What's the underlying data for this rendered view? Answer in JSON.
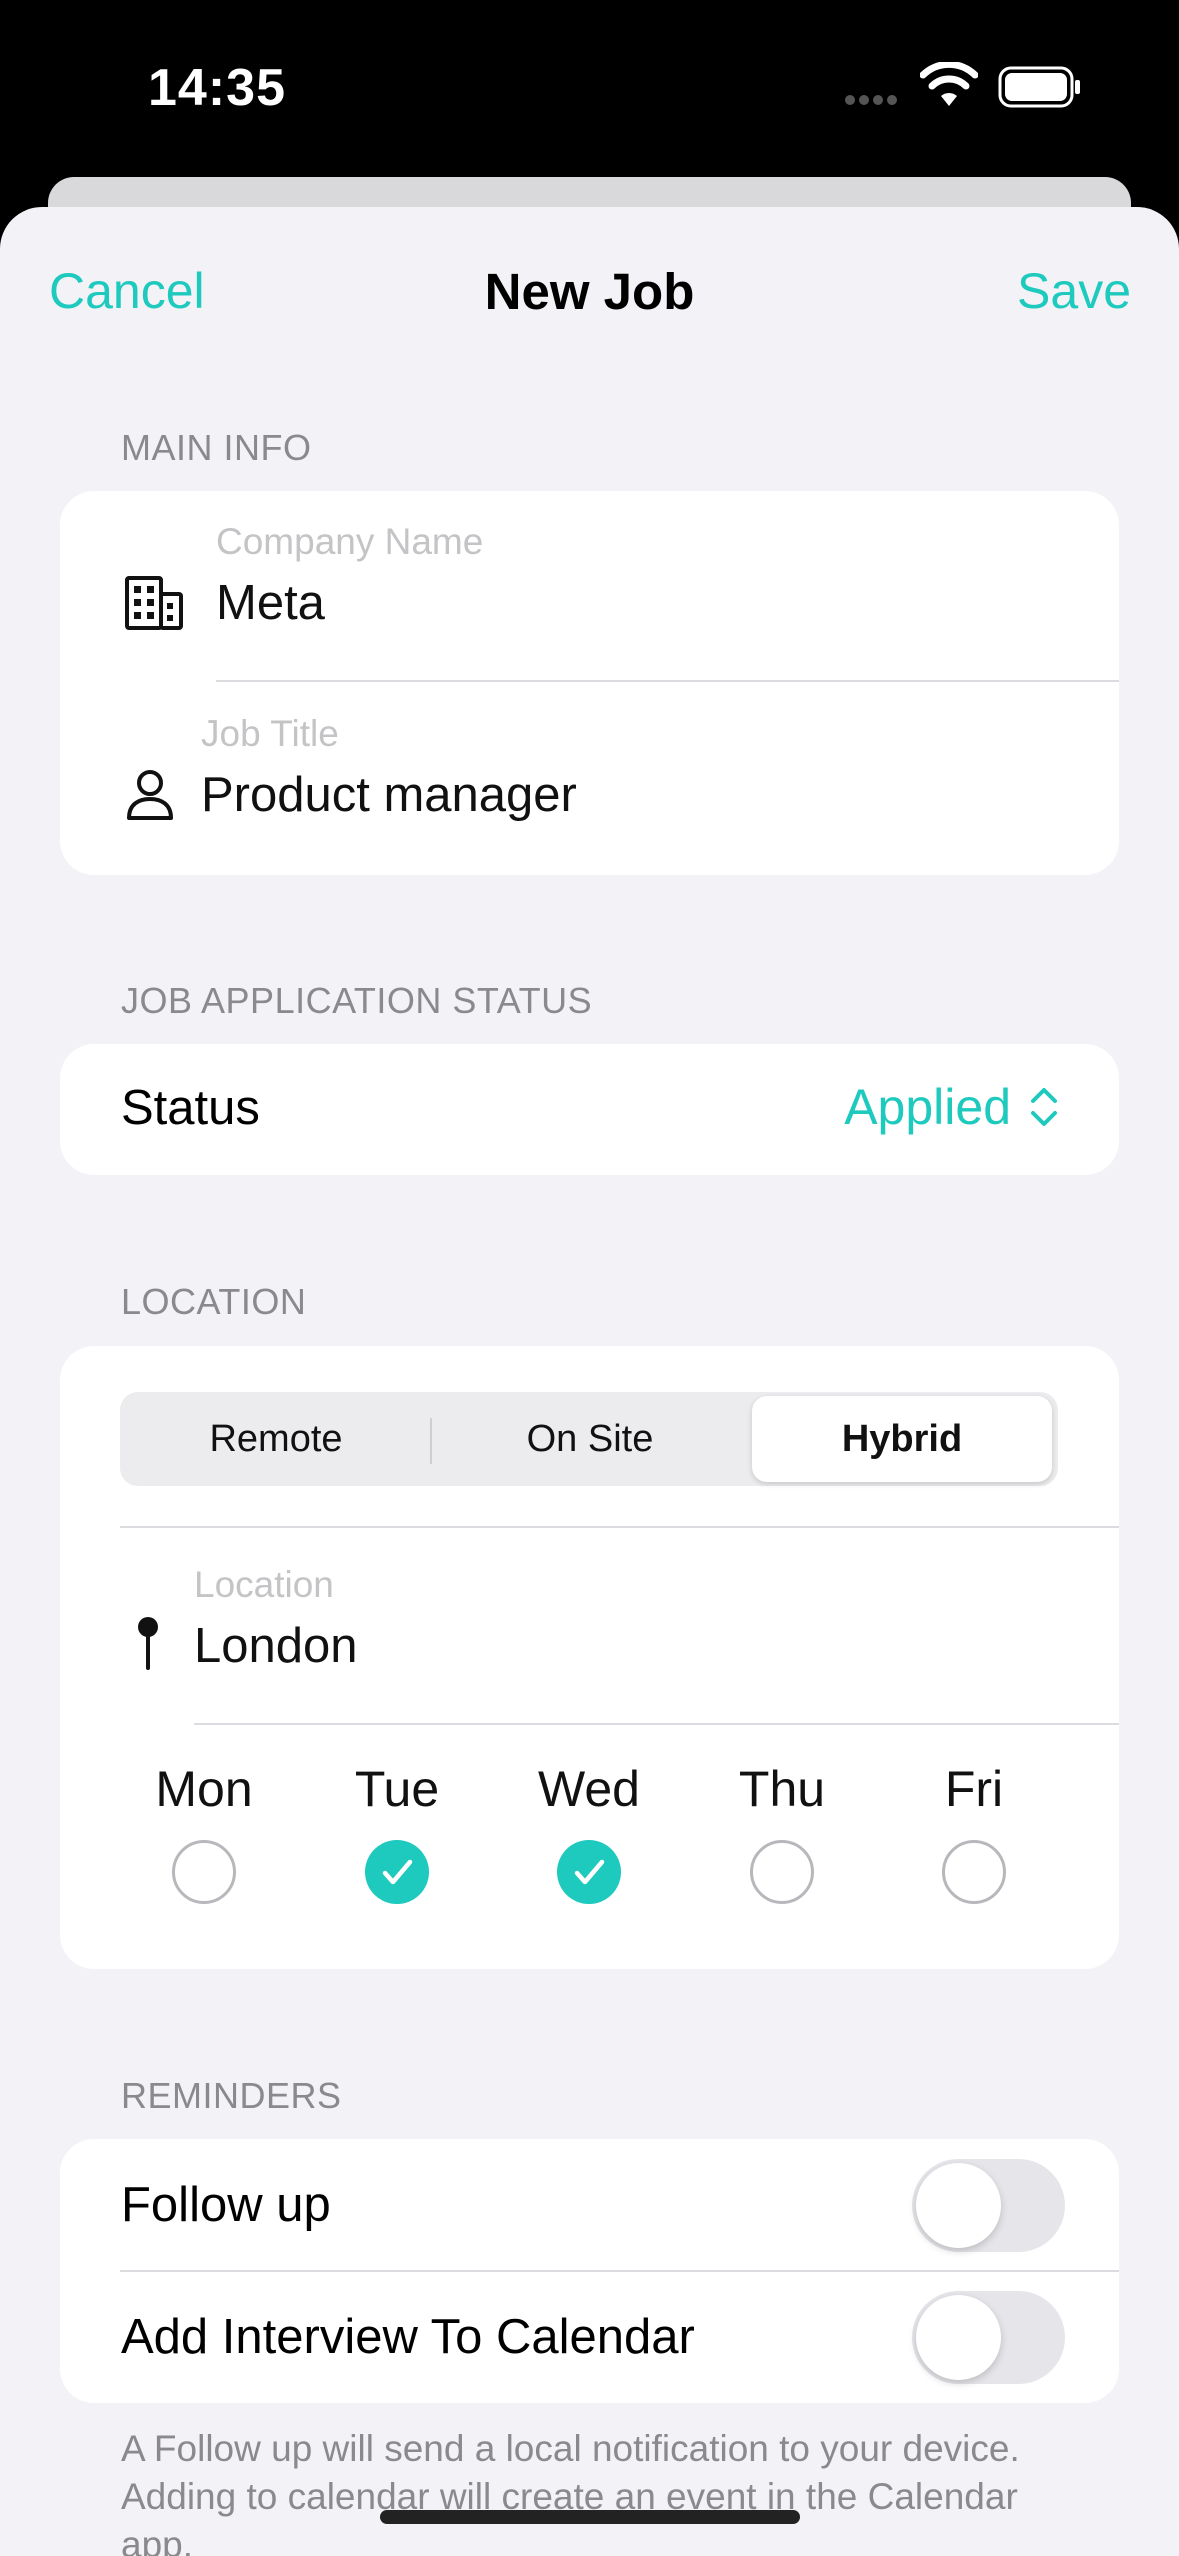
{
  "status_bar": {
    "time": "14:35"
  },
  "nav": {
    "cancel_label": "Cancel",
    "title": "New Job",
    "save_label": "Save"
  },
  "main_info": {
    "section_label": "MAIN INFO",
    "company": {
      "caption": "Company Name",
      "value": "Meta",
      "icon": "building-icon"
    },
    "job_title": {
      "caption": "Job Title",
      "value": "Product manager",
      "icon": "person-icon"
    }
  },
  "status": {
    "section_label": "JOB APPLICATION STATUS",
    "label": "Status",
    "value": "Applied",
    "icon": "chevron-up-down-icon"
  },
  "location": {
    "section_label": "LOCATION",
    "work_modes": [
      "Remote",
      "On Site",
      "Hybrid"
    ],
    "selected_mode": "Hybrid",
    "field": {
      "caption": "Location",
      "value": "London",
      "icon": "pin-icon"
    },
    "days": [
      {
        "label": "Mon",
        "checked": false
      },
      {
        "label": "Tue",
        "checked": true
      },
      {
        "label": "Wed",
        "checked": true
      },
      {
        "label": "Thu",
        "checked": false
      },
      {
        "label": "Fri",
        "checked": false
      }
    ]
  },
  "reminders": {
    "section_label": "REMINDERS",
    "follow_up": {
      "label": "Follow up",
      "enabled": false
    },
    "calendar": {
      "label": "Add Interview To Calendar",
      "enabled": false
    },
    "footer": "A Follow up will send a local notification to your device. Adding to calendar will create an event in the Calendar app."
  },
  "colors": {
    "accent": "#1ec9bd",
    "background": "#f2f2f7",
    "card": "#ffffff",
    "secondary_text": "#8a8a8e"
  }
}
